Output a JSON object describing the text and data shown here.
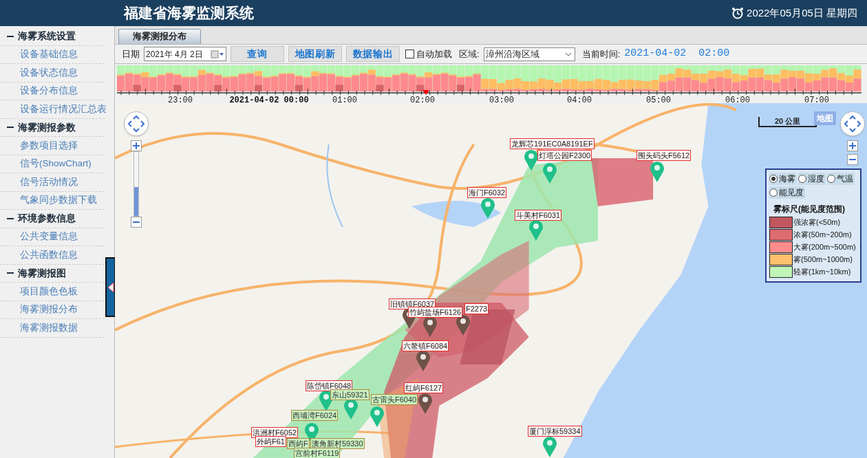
{
  "header": {
    "title": "福建省海雾监测系统",
    "date": "2022年05月05日 星期四"
  },
  "sidebar": {
    "groups": [
      {
        "title": "海雾系统设置",
        "expanded": true,
        "items": [
          "设备基础信息",
          "设备状态信息",
          "设备分布信息",
          "设备运行情况汇总表"
        ]
      },
      {
        "title": "海雾测报参数",
        "expanded": true,
        "items": [
          "参数项目选择",
          "信号(ShowChart)",
          "信号活动情况",
          "气象同步数据下载"
        ]
      },
      {
        "title": "环境参数信息",
        "expanded": true,
        "items": [
          "公共变量信息",
          "公共函数信息"
        ]
      },
      {
        "title": "海雾测报图",
        "expanded": true,
        "items": [
          "项目颜色色板",
          "海雾测报分布",
          "海雾测报数据"
        ]
      }
    ]
  },
  "tabs": [
    {
      "label": "海雾测报分布",
      "selected": true
    }
  ],
  "toolbar": {
    "date_label": "日期",
    "date_value": "2021年 4月 2日",
    "buttons": [
      "查询",
      "地图刷新",
      "数据输出"
    ],
    "autoload": {
      "label": "自动加载",
      "checked": false
    },
    "region_label": "区域:",
    "region_value": "漳州沿海区域",
    "time_label": "当前时间:",
    "time_value": "2021-04-02  02:00"
  },
  "timeline": {
    "ticks": [
      {
        "label": "23:00",
        "kind": "hour"
      },
      {
        "label": "2021-04-02 00:00",
        "kind": "date"
      },
      {
        "label": "01:00",
        "kind": "hour"
      },
      {
        "label": "02:00",
        "kind": "hour"
      },
      {
        "label": "03:00",
        "kind": "hour"
      },
      {
        "label": "04:00",
        "kind": "hour"
      },
      {
        "label": "05:00",
        "kind": "hour"
      },
      {
        "label": "06:00",
        "kind": "hour"
      },
      {
        "label": "07:00",
        "kind": "hour"
      }
    ],
    "position": {
      "level": 0.415
    }
  },
  "map": {
    "scale": "20 公里",
    "map_button": "地图",
    "zoom": {
      "level": 0.45
    },
    "stations": [
      {
        "label": "龙辉芯191EC0A8191EF",
        "kind": "marked",
        "color": "#1fc08a"
      },
      {
        "label": "灯塔公园F2300",
        "kind": "marked",
        "color": "#1fc08a"
      },
      {
        "label": "围头码头F5612",
        "kind": "marked",
        "color": "#1fc08a"
      },
      {
        "label": "海门F6032",
        "kind": "marked",
        "color": "#1fc08a"
      },
      {
        "label": "斗美村F6031",
        "kind": "marked",
        "color": "#1fc08a"
      },
      {
        "label": "F2273",
        "kind": "marked",
        "color": "#6e5248"
      },
      {
        "label": "旧镇镇F6037",
        "kind": "marked",
        "color": "#6e5248"
      },
      {
        "label": "竹屿盐场F6126",
        "kind": "marked",
        "color": "#6e5248"
      },
      {
        "label": "六鳌镇F6084",
        "kind": "marked",
        "color": "#6e5248"
      },
      {
        "label": "红屿F6127",
        "kind": "marked",
        "color": "#6e5248"
      },
      {
        "label": "陈岱镇F6048",
        "kind": "marked",
        "color": "#1fc08a"
      },
      {
        "label": "东山59321",
        "kind": "plain",
        "color": "#1fc08a"
      },
      {
        "label": "古雷头F6040",
        "kind": "plain",
        "color": "#1fc08a"
      },
      {
        "label": "西埔湾F6024",
        "kind": "plain",
        "color": "#1fc08a"
      },
      {
        "label": "洪洲村F6052",
        "kind": "marked"
      },
      {
        "label": "外屿F61",
        "kind": "marked"
      },
      {
        "label": "西屿F",
        "kind": "plain"
      },
      {
        "label": "澳角新村59330",
        "kind": "plain"
      },
      {
        "label": "宫前村F6119",
        "kind": "plain"
      },
      {
        "label": "厦门浮标59334",
        "kind": "marked",
        "color": "#1fc08a"
      }
    ]
  },
  "legend": {
    "options": [
      {
        "label": "海雾",
        "selected": true
      },
      {
        "label": "湿度",
        "selected": false
      },
      {
        "label": "气温",
        "selected": false
      },
      {
        "label": "能见度",
        "selected": false
      }
    ],
    "title": "雾标尺(能见度范围)",
    "levels": [
      {
        "label": "强浓雾(<50m)",
        "color": "#c0575f"
      },
      {
        "label": "浓雾(50m~200m)",
        "color": "#df6b72"
      },
      {
        "label": "大雾(200m~500m)",
        "color": "#ff8c8c"
      },
      {
        "label": "雾(500m~1000m)",
        "color": "#ffbf6b"
      },
      {
        "label": "轻雾(1km~10km)",
        "color": "#c0f5b8"
      }
    ]
  }
}
